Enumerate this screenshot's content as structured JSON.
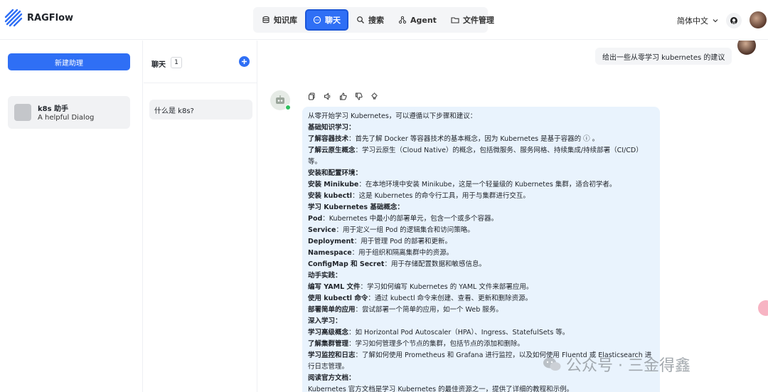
{
  "app": {
    "name": "RAGFlow"
  },
  "nav": {
    "items": [
      {
        "label": "知识库",
        "icon": "database-icon"
      },
      {
        "label": "聊天",
        "icon": "chat-icon",
        "active": true
      },
      {
        "label": "搜索",
        "icon": "search-icon"
      },
      {
        "label": "Agent",
        "icon": "agent-icon"
      },
      {
        "label": "文件管理",
        "icon": "folder-icon"
      }
    ]
  },
  "header": {
    "language": "简体中文"
  },
  "sidebar": {
    "new_button": "新建助理",
    "assistant": {
      "name": "k8s 助手",
      "description": "A helpful Dialog"
    }
  },
  "conversations": {
    "title": "聊天",
    "count": "1",
    "items": [
      {
        "label": "什么是 k8s?"
      }
    ]
  },
  "chat": {
    "user_message": "给出一些从零学习 kubernetes 的建议",
    "answer": {
      "intro": "从零开始学习 Kubernetes，可以遵循以下步骤和建议：",
      "sections": [
        {
          "heading": "基础知识学习：",
          "items": [
            {
              "bold": "了解容器技术",
              "text": "：首先了解 Docker 等容器技术的基本概念，因为 Kubernetes 是基于容器的 ⓘ 。"
            },
            {
              "bold": "了解云原生概念",
              "text": "：学习云原生（Cloud Native）的概念，包括微服务、服务网格、持续集成/持续部署（CI/CD）等。"
            }
          ]
        },
        {
          "heading": "安装和配置环境：",
          "items": [
            {
              "bold": "安装 Minikube",
              "text": "：在本地环境中安装 Minikube，这是一个轻量级的 Kubernetes 集群，适合初学者。"
            },
            {
              "bold": "安装 kubectl",
              "text": "：这是 Kubernetes 的命令行工具，用于与集群进行交互。"
            }
          ]
        },
        {
          "heading": "学习 Kubernetes 基础概念：",
          "items": [
            {
              "bold": "Pod",
              "text": "：Kubernetes 中最小的部署单元，包含一个或多个容器。"
            },
            {
              "bold": "Service",
              "text": "：用于定义一组 Pod 的逻辑集合和访问策略。"
            },
            {
              "bold": "Deployment",
              "text": "：用于管理 Pod 的部署和更新。"
            },
            {
              "bold": "Namespace",
              "text": "：用于组织和隔离集群中的资源。"
            },
            {
              "bold": "ConfigMap 和 Secret",
              "text": "：用于存储配置数据和敏感信息。"
            }
          ]
        },
        {
          "heading": "动手实践：",
          "items": [
            {
              "bold": "编写 YAML 文件",
              "text": "：学习如何编写 Kubernetes 的 YAML 文件来部署应用。"
            },
            {
              "bold": "使用 kubectl 命令",
              "text": "：通过 kubectl 命令来创建、查看、更新和删除资源。"
            },
            {
              "bold": "部署简单的应用",
              "text": "：尝试部署一个简单的应用，如一个 Web 服务。"
            }
          ]
        },
        {
          "heading": "深入学习：",
          "items": [
            {
              "bold": "学习高级概念",
              "text": "：如 Horizontal Pod Autoscaler（HPA）、Ingress、StatefulSets 等。"
            },
            {
              "bold": "了解集群管理",
              "text": "：学习如何管理多个节点的集群，包括节点的添加和删除。"
            },
            {
              "bold": "学习监控和日志",
              "text": "：了解如何使用 Prometheus 和 Grafana 进行监控，以及如何使用 Fluentd 或 Elasticsearch 进行日志管理。"
            }
          ]
        },
        {
          "heading": "阅读官方文档：",
          "items": [
            {
              "bold": "",
              "text": "Kubernetes 官方文档是学习 Kubernetes 的最佳资源之一，提供了详细的教程和示例。"
            }
          ]
        }
      ]
    }
  },
  "watermark": "公众号 · 三金得鑫"
}
